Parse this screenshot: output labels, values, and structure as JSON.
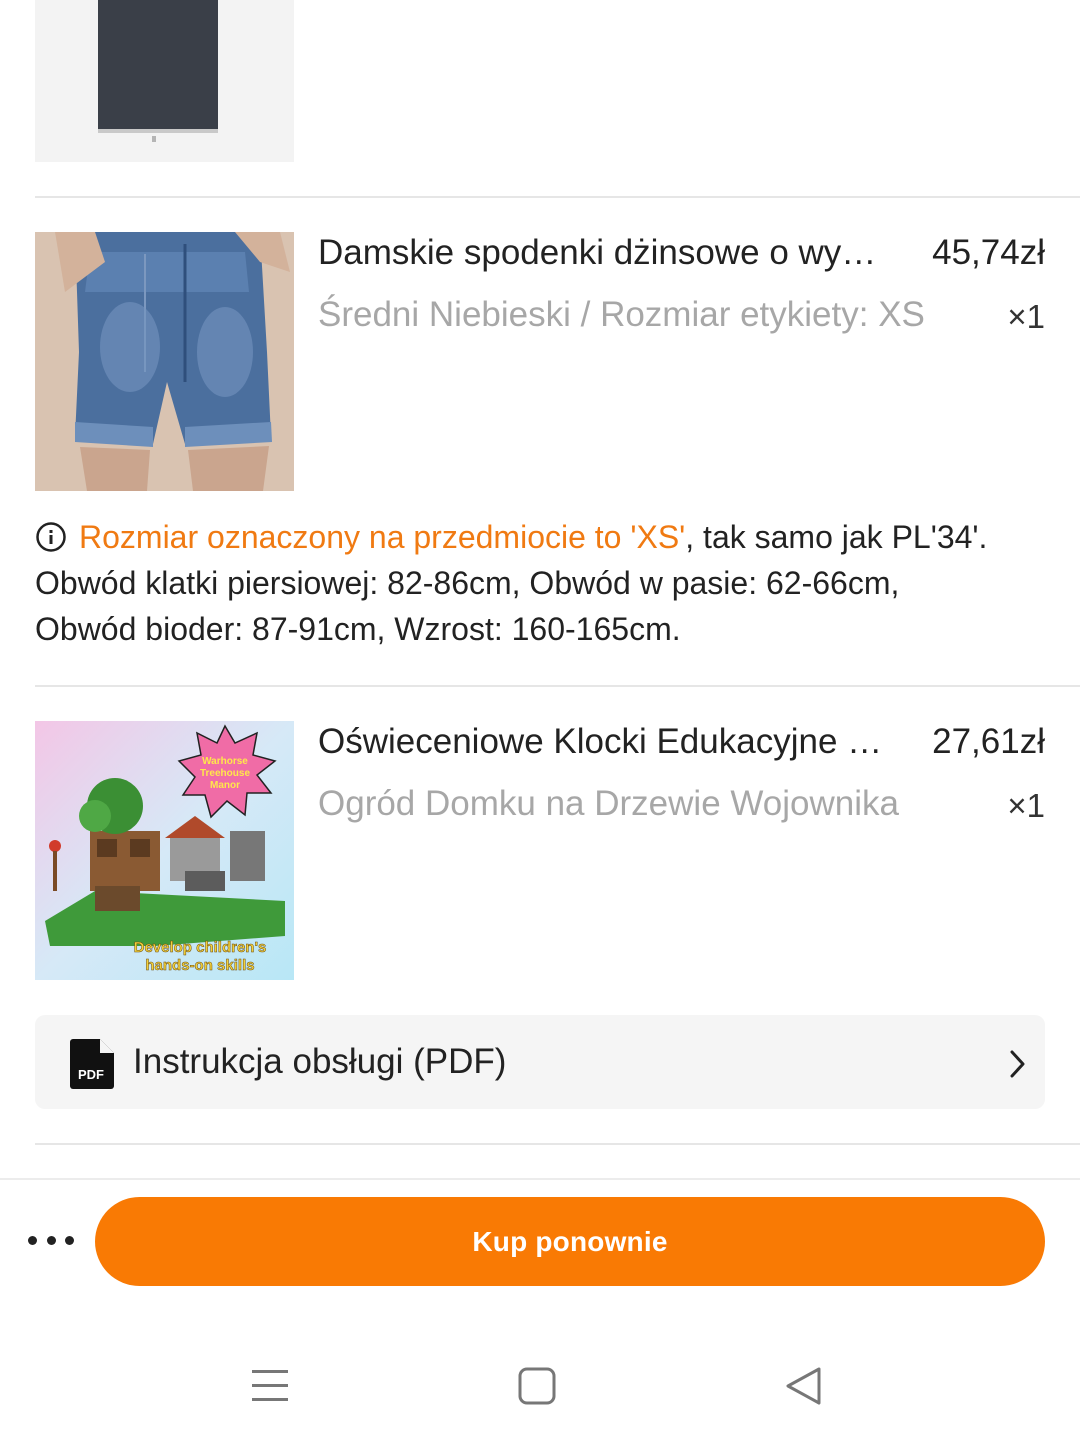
{
  "products": [
    {
      "title": "Damskie spodenki dżinsowe o wy…",
      "price": "45,74zł",
      "variant": "Średni Niebieski / Rozmiar etykiety: XS",
      "quantity": "×1"
    },
    {
      "title": "Oświeceniowe Klocki Edukacyjne …",
      "price": "27,61zł",
      "variant": "Ogród Domku na Drzewie Wojownika",
      "quantity": "×1",
      "image_badge_lines": [
        "Warhorse",
        "Treehouse",
        "Manor"
      ],
      "image_caption_lines": [
        "Develop children's",
        "hands-on skills"
      ]
    }
  ],
  "size_note": {
    "highlight": "Rozmiar oznaczony na przedmiocie to 'XS'",
    "line1_rest": ", tak samo jak PL'34'.",
    "line2": "Obwód klatki piersiowej: 82-86cm, Obwód w pasie: 62-66cm,",
    "line3": "Obwód bioder: 87-91cm, Wzrost: 160-165cm."
  },
  "manual": {
    "icon_text": "PDF",
    "label": "Instrukcja obsługi (PDF)"
  },
  "actions": {
    "buy_again_label": "Kup ponownie"
  },
  "colors": {
    "accent": "#f97a04",
    "note_highlight": "#f07a12",
    "secondary_text": "#a7a7a7"
  },
  "icons": {
    "info": "info-circle-icon",
    "pdf": "pdf-file-icon",
    "chevron": "chevron-right-icon",
    "more": "more-horizontal-icon",
    "nav_menu": "menu-icon",
    "nav_home": "home-square-icon",
    "nav_back": "back-triangle-icon"
  }
}
